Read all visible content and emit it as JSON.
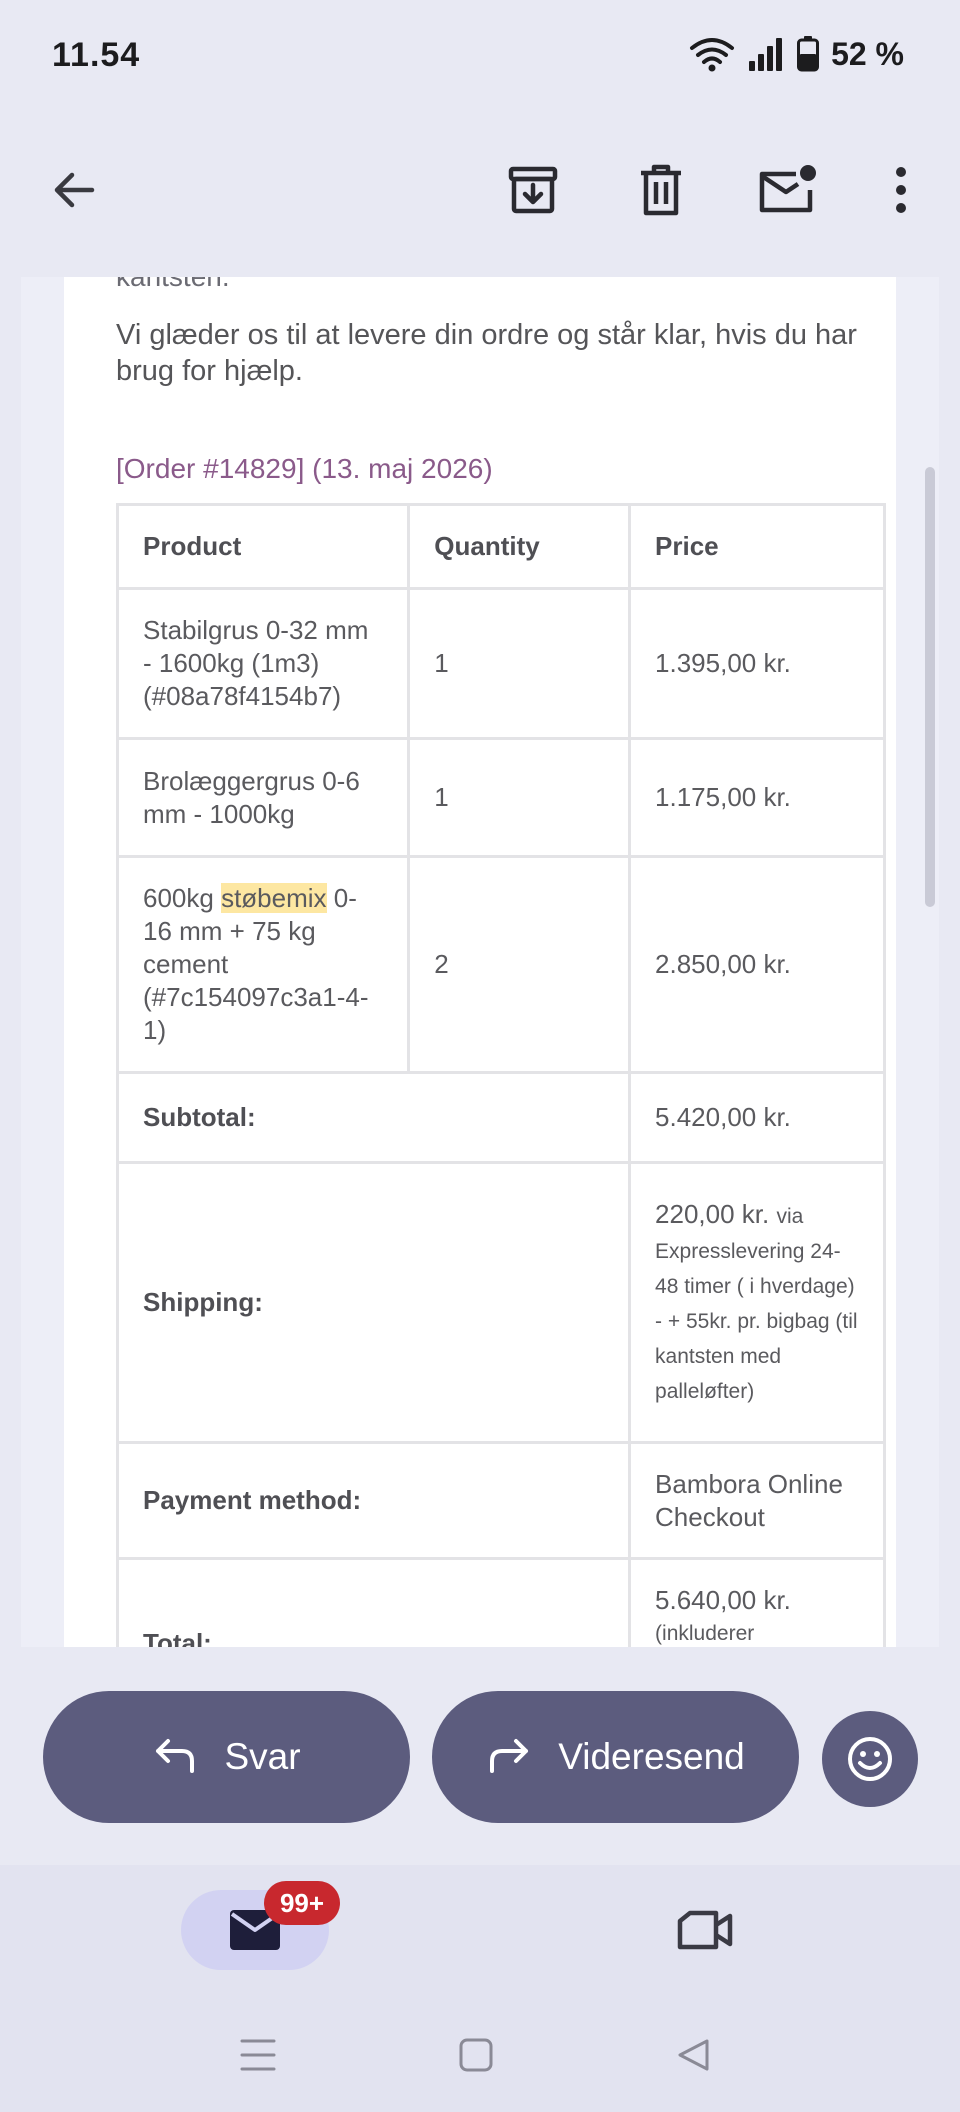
{
  "status_bar": {
    "time": "11.54",
    "battery": "52 %",
    "icons": [
      "wifi-icon",
      "signal-icon",
      "battery-icon"
    ]
  },
  "toolbar": {
    "icons": [
      "back-arrow-icon",
      "archive-icon",
      "delete-icon",
      "mark-unread-icon",
      "more-icon"
    ]
  },
  "email": {
    "cutoff_text": "kantsten.",
    "intro": "Vi glæder os til at levere din ordre og står klar, hvis du har brug for hjælp.",
    "order_heading": "[Order #14829] (13. maj 2026)",
    "table": {
      "headers": [
        "Product",
        "Quantity",
        "Price"
      ],
      "rows": [
        {
          "product": "Stabilgrus 0-32 mm - 1600kg (1m3) (#08a78f4154b7)",
          "quantity": "1",
          "price": "1.395,00 kr."
        },
        {
          "product": "Brolæggergrus 0-6 mm - 1000kg",
          "quantity": "1",
          "price": "1.175,00 kr."
        },
        {
          "product_before": "600kg ",
          "product_highlight": "støbemix",
          "product_after": " 0-16 mm + 75 kg cement (#7c154097c3a1-4-1)",
          "quantity": "2",
          "price": "2.850,00 kr."
        }
      ],
      "subtotal_label": "Subtotal:",
      "subtotal_value": "5.420,00 kr.",
      "shipping_label": "Shipping:",
      "shipping_value": "220,00 kr.",
      "shipping_via": "via Expresslevering 24-48 timer ( i hverdage) - + 55kr. pr. bigbag (til kantsten med palleløfter)",
      "payment_label": "Payment method:",
      "payment_value": "Bambora Online Checkout",
      "total_label": "Total:",
      "total_value": "5.640,00 kr.",
      "total_note": "(inkluderer"
    }
  },
  "actions": {
    "reply": "Svar",
    "forward": "Videresend"
  },
  "bottom_nav": {
    "mail_badge": "99+"
  },
  "colors": {
    "accent_button": "#5c5c7e",
    "badge": "#c8282e",
    "highlight": "#fde7a2",
    "order_heading": "#8a5a8a"
  }
}
